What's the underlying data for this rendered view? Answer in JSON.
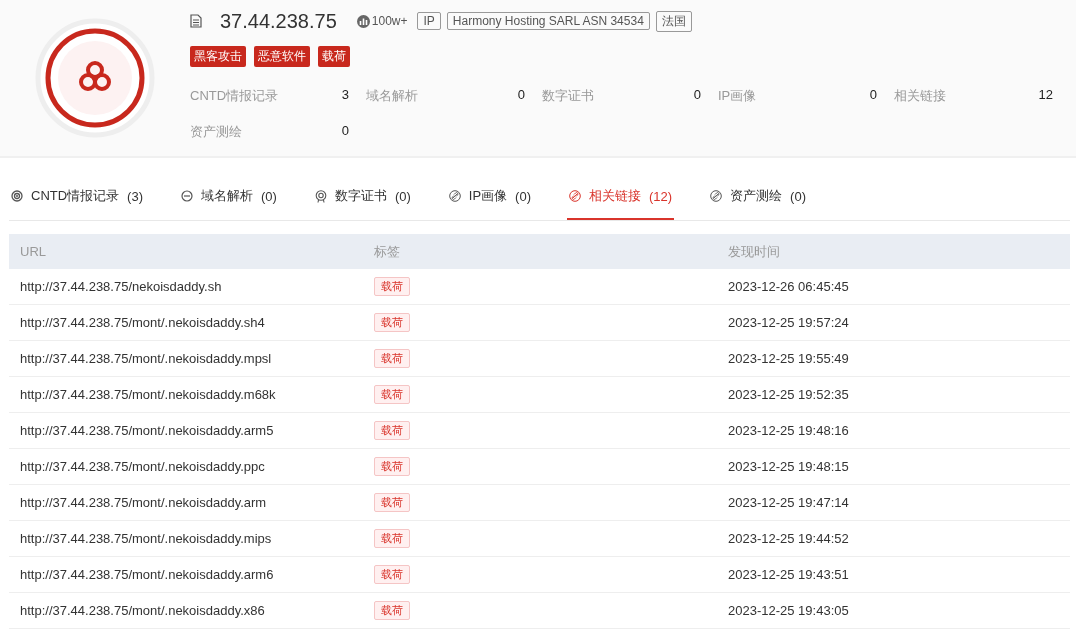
{
  "header": {
    "ip": "37.44.238.75",
    "heat": "100w+",
    "badges": [
      "IP",
      "Harmony Hosting SARL ASN 34534",
      "法国"
    ],
    "tags": [
      "黑客攻击",
      "恶意软件",
      "载荷"
    ],
    "stats": [
      {
        "label": "CNTD情报记录",
        "value": "3"
      },
      {
        "label": "域名解析",
        "value": "0"
      },
      {
        "label": "数字证书",
        "value": "0"
      },
      {
        "label": "IP画像",
        "value": "0"
      },
      {
        "label": "相关链接",
        "value": "12"
      },
      {
        "label": "资产测绘",
        "value": "0"
      }
    ]
  },
  "tabs": [
    {
      "label": "CNTD情报记录",
      "count": "(3)",
      "kind": "radar",
      "selected": false
    },
    {
      "label": "域名解析",
      "count": "(0)",
      "kind": "dns",
      "selected": false
    },
    {
      "label": "数字证书",
      "count": "(0)",
      "kind": "cert",
      "selected": false
    },
    {
      "label": "IP画像",
      "count": "(0)",
      "kind": "link",
      "selected": false
    },
    {
      "label": "相关链接",
      "count": "(12)",
      "kind": "link",
      "selected": true
    },
    {
      "label": "资产测绘",
      "count": "(0)",
      "kind": "link",
      "selected": false
    }
  ],
  "table": {
    "columns": [
      "URL",
      "标签",
      "发现时间"
    ],
    "rows": [
      {
        "url": "http://37.44.238.75/nekoisdaddy.sh",
        "tag": "载荷",
        "time": "2023-12-26 06:45:45"
      },
      {
        "url": "http://37.44.238.75/mont/.nekoisdaddy.sh4",
        "tag": "载荷",
        "time": "2023-12-25 19:57:24"
      },
      {
        "url": "http://37.44.238.75/mont/.nekoisdaddy.mpsl",
        "tag": "载荷",
        "time": "2023-12-25 19:55:49"
      },
      {
        "url": "http://37.44.238.75/mont/.nekoisdaddy.m68k",
        "tag": "载荷",
        "time": "2023-12-25 19:52:35"
      },
      {
        "url": "http://37.44.238.75/mont/.nekoisdaddy.arm5",
        "tag": "载荷",
        "time": "2023-12-25 19:48:16"
      },
      {
        "url": "http://37.44.238.75/mont/.nekoisdaddy.ppc",
        "tag": "载荷",
        "time": "2023-12-25 19:48:15"
      },
      {
        "url": "http://37.44.238.75/mont/.nekoisdaddy.arm",
        "tag": "载荷",
        "time": "2023-12-25 19:47:14"
      },
      {
        "url": "http://37.44.238.75/mont/.nekoisdaddy.mips",
        "tag": "载荷",
        "time": "2023-12-25 19:44:52"
      },
      {
        "url": "http://37.44.238.75/mont/.nekoisdaddy.arm6",
        "tag": "载荷",
        "time": "2023-12-25 19:43:51"
      },
      {
        "url": "http://37.44.238.75/mont/.nekoisdaddy.x86",
        "tag": "载荷",
        "time": "2023-12-25 19:43:05"
      }
    ]
  }
}
